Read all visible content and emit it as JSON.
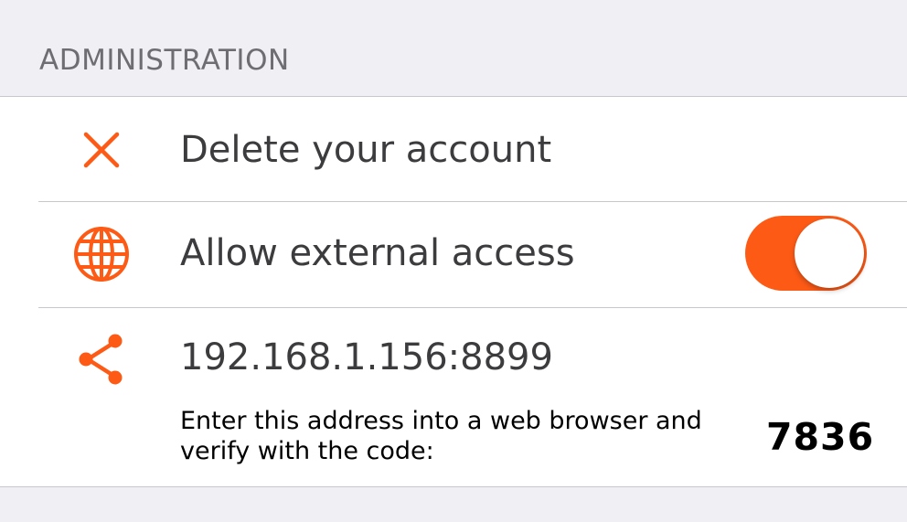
{
  "section": {
    "title": "ADMINISTRATION"
  },
  "rows": {
    "delete": {
      "label": "Delete your account",
      "icon": "close-x-icon"
    },
    "external": {
      "label": "Allow external access",
      "icon": "globe-icon",
      "toggle_on": true
    },
    "address": {
      "label": "192.168.1.156:8899",
      "icon": "share-icon",
      "instructions": "Enter this address into a web browser and verify with the code:",
      "code": "7836"
    }
  },
  "colors": {
    "accent": "#fd5a16",
    "background": "#efeff4",
    "separator": "#c8c7cc",
    "text": "#3c3c3e"
  }
}
